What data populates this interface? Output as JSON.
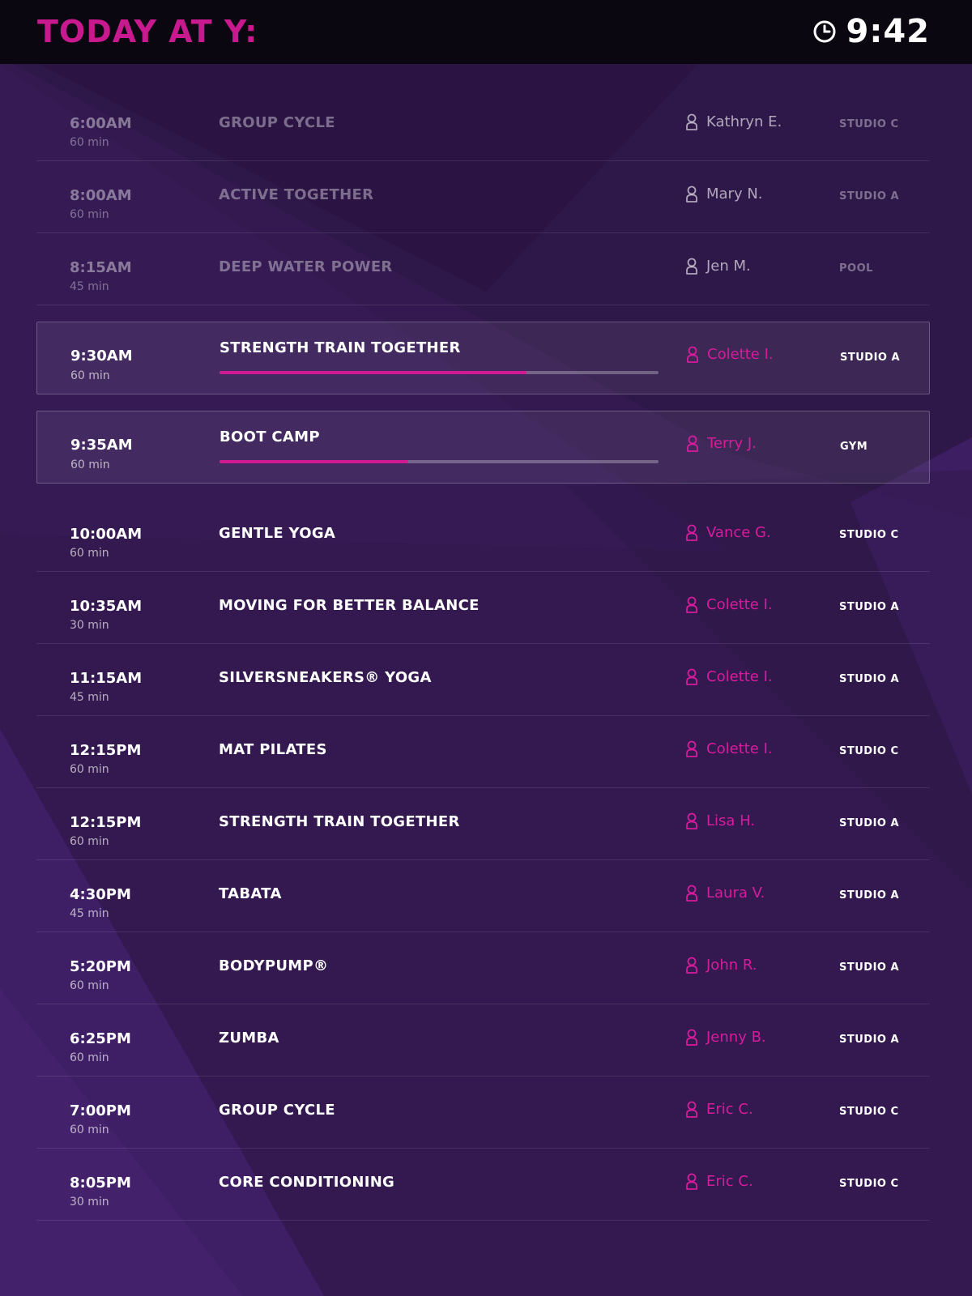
{
  "header": {
    "title": "TODAY AT Y:",
    "clock_icon": "clock-icon",
    "time": "9:42",
    "accent_color": "#c8198e"
  },
  "schedule": [
    {
      "time": "6:00AM",
      "duration": "60 min",
      "class": "GROUP CYCLE",
      "instructor": "Kathryn E.",
      "room": "STUDIO C",
      "state": "past"
    },
    {
      "time": "8:00AM",
      "duration": "60 min",
      "class": "ACTIVE TOGETHER",
      "instructor": "Mary N.",
      "room": "STUDIO A",
      "state": "past"
    },
    {
      "time": "8:15AM",
      "duration": "45 min",
      "class": "DEEP WATER POWER",
      "instructor": "Jen M.",
      "room": "POOL",
      "state": "past"
    },
    {
      "time": "9:30AM",
      "duration": "60 min",
      "class": "STRENGTH TRAIN TOGETHER",
      "instructor": "Colette I.",
      "room": "STUDIO A",
      "state": "current",
      "progress": 0.7
    },
    {
      "time": "9:35AM",
      "duration": "60 min",
      "class": "BOOT CAMP",
      "instructor": "Terry J.",
      "room": "GYM",
      "state": "current",
      "progress": 0.43
    },
    {
      "time": "10:00AM",
      "duration": "60 min",
      "class": "GENTLE YOGA",
      "instructor": "Vance G.",
      "room": "STUDIO C",
      "state": "upcoming"
    },
    {
      "time": "10:35AM",
      "duration": "30 min",
      "class": "MOVING FOR BETTER BALANCE",
      "instructor": "Colette I.",
      "room": "STUDIO A",
      "state": "upcoming"
    },
    {
      "time": "11:15AM",
      "duration": "45 min",
      "class": "SILVERSNEAKERS® YOGA",
      "instructor": "Colette I.",
      "room": "STUDIO A",
      "state": "upcoming"
    },
    {
      "time": "12:15PM",
      "duration": "60 min",
      "class": "MAT PILATES",
      "instructor": "Colette I.",
      "room": "STUDIO C",
      "state": "upcoming"
    },
    {
      "time": "12:15PM",
      "duration": "60 min",
      "class": "STRENGTH TRAIN TOGETHER",
      "instructor": "Lisa H.",
      "room": "STUDIO A",
      "state": "upcoming"
    },
    {
      "time": "4:30PM",
      "duration": "45 min",
      "class": "TABATA",
      "instructor": "Laura V.",
      "room": "STUDIO A",
      "state": "upcoming"
    },
    {
      "time": "5:20PM",
      "duration": "60 min",
      "class": "BODYPUMP®",
      "instructor": "John R.",
      "room": "STUDIO A",
      "state": "upcoming"
    },
    {
      "time": "6:25PM",
      "duration": "60 min",
      "class": "ZUMBA",
      "instructor": "Jenny B.",
      "room": "STUDIO A",
      "state": "upcoming"
    },
    {
      "time": "7:00PM",
      "duration": "60 min",
      "class": "GROUP CYCLE",
      "instructor": "Eric C.",
      "room": "STUDIO C",
      "state": "upcoming"
    },
    {
      "time": "8:05PM",
      "duration": "30 min",
      "class": "CORE CONDITIONING",
      "instructor": "Eric C.",
      "room": "STUDIO C",
      "state": "upcoming"
    }
  ],
  "icons": {
    "instructor": "person-icon"
  },
  "colors": {
    "instructor": "#d81b9c",
    "progress": "#cf1a93",
    "background": "#2f1a4e"
  }
}
